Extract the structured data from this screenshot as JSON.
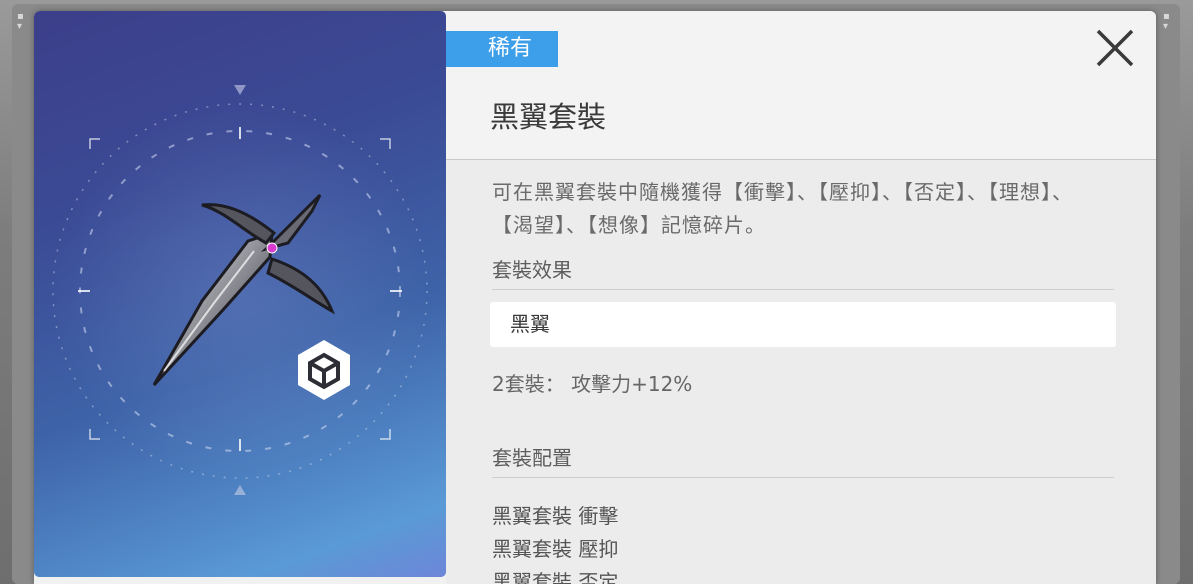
{
  "item": {
    "rarity": "稀有",
    "title": "黑翼套裝",
    "description": "可在黑翼套裝中隨機獲得【衝擊】、【壓抑】、【否定】、【理想】、【渴望】、【想像】記憶碎片。"
  },
  "set_effect": {
    "heading": "套裝效果",
    "set_name": "黑翼",
    "bonus": "2套裝： 攻擊力+12%"
  },
  "set_config": {
    "heading": "套裝配置",
    "items": [
      "黑翼套裝 衝擊",
      "黑翼套裝 壓抑",
      "黑翼套裝 否定"
    ]
  },
  "icons": {
    "close": "close-x-icon",
    "type": "cube-hexagon-icon",
    "artwork": "black-wing-dagger-artwork"
  },
  "colors": {
    "rarity_badge": "#3d9ee9",
    "art_panel_top": "#3c3f8a",
    "art_panel_bottom": "#5a9ad6"
  }
}
